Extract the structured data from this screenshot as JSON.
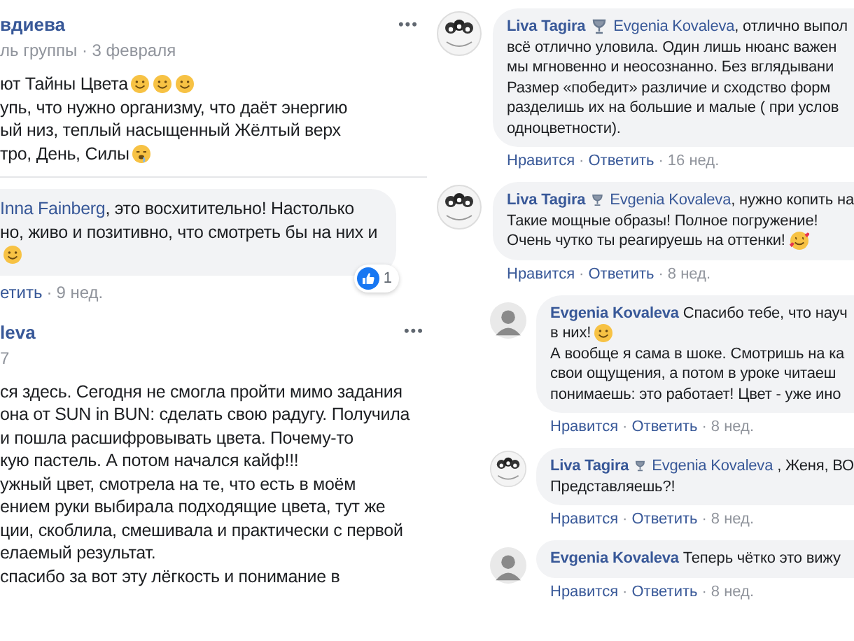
{
  "left_column": {
    "post": {
      "author": "вдиева",
      "meta": "ль группы · 3 февраля",
      "menu": "•••",
      "lines": [
        {
          "text": "ют Тайны Цвета",
          "emoji": [
            {
              "kind": "smile"
            },
            {
              "kind": "smile"
            },
            {
              "kind": "smile"
            }
          ]
        },
        {
          "text": "упь, что нужно организму, что даёт энергию"
        },
        {
          "text": "ый низ, теплый насыщенный Жёлтый верх"
        },
        {
          "text": "тро, День, Силы",
          "emoji": [
            {
              "kind": "drool"
            }
          ]
        }
      ]
    },
    "reply": {
      "mention": "Inna Fainberg",
      "lines": [
        {
          "text": ", это восхитительно! Настолько"
        },
        {
          "text": "но, живо и позитивно, что смотреть бы на них и"
        },
        {
          "emoji": [
            {
              "kind": "smile"
            }
          ]
        }
      ],
      "reaction_count": "1",
      "actions": [
        {
          "kind": "link",
          "text": "етить"
        },
        {
          "kind": "sep",
          "text": "·"
        },
        {
          "kind": "time",
          "text": "9 нед."
        }
      ]
    },
    "post2": {
      "author": "leva",
      "meta": "7",
      "menu": "•••",
      "lines": [
        {
          "text": "ся здесь. Сегодня не смогла пройти мимо задания"
        },
        {
          "text": "она от SUN in BUN: сделать свою радугу. Получила"
        },
        {
          "text": "и пошла расшифровывать цвета. Почему-то"
        },
        {
          "text": "кую пастель. А потом начался кайф!!!"
        },
        {
          "text": "ужный цвет, смотрела на те, что есть в моём"
        },
        {
          "text": "ением руки выбирала подходящие цвета, тут же"
        },
        {
          "text": "ции, скоблила, смешивала и практически с первой"
        },
        {
          "text": "елаемый результат."
        },
        {
          "text": "спасибо за вот эту лёгкость и понимание в"
        }
      ]
    }
  },
  "right_column": {
    "comments": [
      {
        "avatar": {
          "kind": "group"
        },
        "author": "Liva Tagira",
        "mention": "Evgenia Kovaleva",
        "first": ", отлично выпол",
        "lines": [
          {
            "text": "всё отлично уловила. Один лишь нюанс важен"
          },
          {
            "text": "мы мгновенно и неосознанно. Без вглядывани"
          },
          {
            "text": "Размер «победит» различие и сходство форм"
          },
          {
            "text": "разделишь их на большие и малые ( при услов"
          },
          {
            "text": "одноцветности)."
          }
        ],
        "actions": [
          {
            "kind": "link",
            "text": "Нравится"
          },
          {
            "kind": "sep",
            "text": "·"
          },
          {
            "kind": "link",
            "text": "Ответить"
          },
          {
            "kind": "sep",
            "text": "·"
          },
          {
            "kind": "time",
            "text": "16 нед."
          }
        ]
      },
      {
        "avatar": {
          "kind": "group"
        },
        "author": "Liva Tagira",
        "mention": "Evgenia Kovaleva",
        "first": ", нужно копить на",
        "lines": [
          {
            "text": "Такие мощные образы! Полное погружение!"
          },
          {
            "text": "Очень чутко ты реагируешь на оттенки!",
            "emoji": [
              {
                "kind": "love"
              }
            ]
          }
        ],
        "actions": [
          {
            "kind": "link",
            "text": "Нравится"
          },
          {
            "kind": "sep",
            "text": "·"
          },
          {
            "kind": "link",
            "text": "Ответить"
          },
          {
            "kind": "sep",
            "text": "·"
          },
          {
            "kind": "time",
            "text": "8 нед."
          }
        ],
        "children": [
          {
            "avatar": {
              "kind": "person"
            },
            "author": "Evgenia Kovaleva",
            "first": " Спасибо тебе, что науч",
            "lines": [
              {
                "text": "в них!",
                "emoji": [
                  {
                    "kind": "smile"
                  }
                ]
              },
              {
                "text": "А вообще я сама в шоке. Смотришь на ка"
              },
              {
                "text": "свои ощущения, а потом в уроке читаеш"
              },
              {
                "text": "понимаешь: это работает! Цвет - уже ино"
              }
            ],
            "actions": [
              {
                "kind": "link",
                "text": "Нравится"
              },
              {
                "kind": "sep",
                "text": "·"
              },
              {
                "kind": "link",
                "text": "Ответить"
              },
              {
                "kind": "sep",
                "text": "·"
              },
              {
                "kind": "time",
                "text": "8 нед."
              }
            ]
          },
          {
            "avatar": {
              "kind": "group"
            },
            "author": "Liva Tagira",
            "mention": "Evgenia Kovaleva",
            "first": " , Женя, ВО",
            "lines": [
              {
                "text": "Представляешь?!"
              }
            ],
            "actions": [
              {
                "kind": "link",
                "text": "Нравится"
              },
              {
                "kind": "sep",
                "text": "·"
              },
              {
                "kind": "link",
                "text": "Ответить"
              },
              {
                "kind": "sep",
                "text": "·"
              },
              {
                "kind": "time",
                "text": "8 нед."
              }
            ]
          },
          {
            "avatar": {
              "kind": "person"
            },
            "author": "Evgenia Kovaleva",
            "first": " Теперь чётко это вижу",
            "actions": [
              {
                "kind": "link",
                "text": "Нравится"
              },
              {
                "kind": "sep",
                "text": "·"
              },
              {
                "kind": "link",
                "text": "Ответить"
              },
              {
                "kind": "sep",
                "text": "·"
              },
              {
                "kind": "time",
                "text": "8 нед."
              }
            ]
          }
        ]
      }
    ]
  }
}
